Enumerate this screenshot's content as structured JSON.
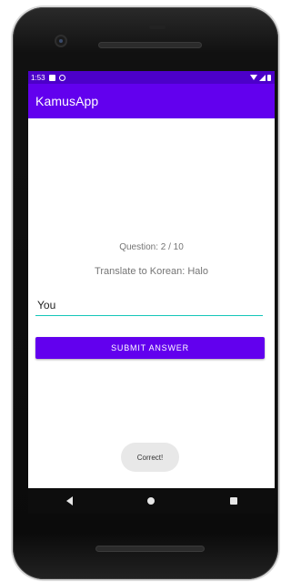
{
  "status_bar": {
    "time": "1:53",
    "icons": [
      "sd-card-icon",
      "sync-icon",
      "wifi-icon",
      "signal-icon",
      "battery-icon"
    ]
  },
  "app_bar": {
    "title": "KamusApp",
    "color": "#6200ee"
  },
  "quiz": {
    "question_counter": "Question: 2 / 10",
    "prompt": "Translate to Korean: Halo"
  },
  "answer_field": {
    "value": "You",
    "underline_color": "#14c6b9"
  },
  "submit_button": {
    "label": "SUBMIT ANSWER",
    "color": "#6200ee"
  },
  "toast": {
    "message": "Correct!"
  },
  "nav_bar": {
    "buttons": [
      "back-icon",
      "home-icon",
      "recents-icon"
    ]
  }
}
